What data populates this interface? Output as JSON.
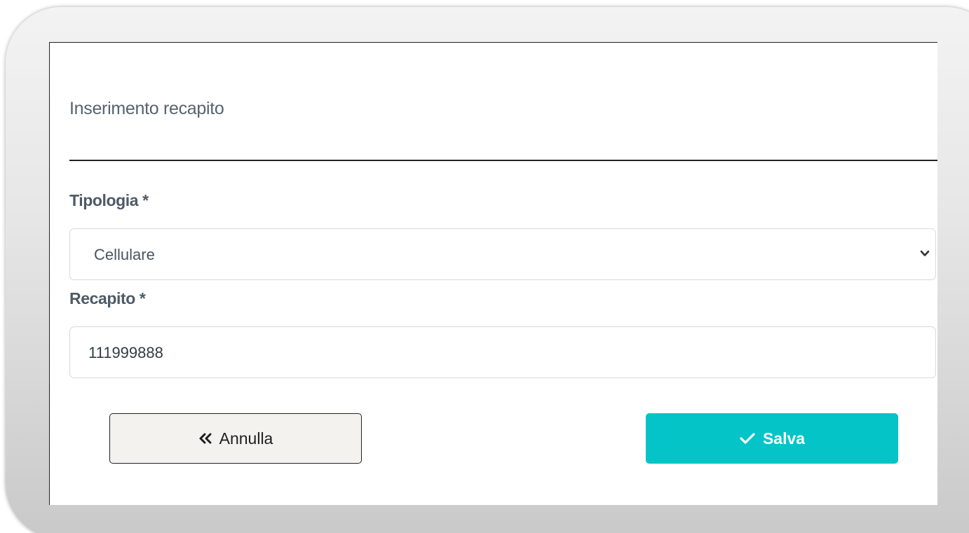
{
  "form": {
    "title": "Inserimento recapito",
    "tipologia_label": "Tipologia *",
    "tipologia_value": "Cellulare",
    "recapito_label": "Recapito *",
    "recapito_value": "111999888"
  },
  "actions": {
    "annulla_label": "Annulla",
    "salva_label": "Salva"
  },
  "colors": {
    "accent": "#05c4c8",
    "label": "#4e5a66",
    "cancel_bg": "#f3f2ee"
  },
  "icons": {
    "annulla": "double-chevron-left-icon",
    "salva": "check-icon",
    "select": "chevron-down-icon"
  }
}
